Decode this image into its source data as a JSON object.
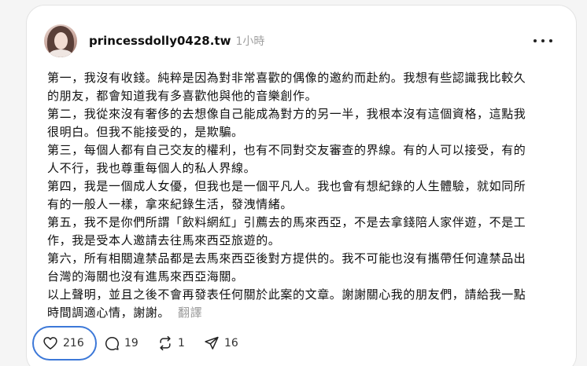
{
  "post": {
    "username": "princessdolly0428.tw",
    "time": "1小時",
    "lines": [
      "第一，我沒有收錢。純粹是因為對非常喜歡的偶像的邀約而赴約。我想有些認識我比較久",
      "的朋友，都會知道我有多喜歡他與他的音樂創作。",
      "第二，我從來沒有奢侈的去想像自己能成為對方的另一半，我根本沒有這個資格，這點我",
      "很明白。但我不能接受的，是欺騙。",
      "第三，每個人都有自己交友的權利，也有不同對交友審查的界線。有的人可以接受，有的",
      "人不行，我也尊重每個人的私人界線。",
      "第四，我是一個成人女優，但我也是一個平凡人。我也會有想紀錄的人生體驗，就如同所",
      "有的一般人一樣，拿來紀錄生活，發洩情緒。",
      "第五，我不是你們所謂「飲料網紅」引薦去的馬來西亞，不是去拿錢陪人家伴遊，不是工",
      "作，我是受本人邀請去往馬來西亞旅遊的。",
      "第六，所有相關違禁品都是去馬來西亞後對方提供的。我不可能也沒有攜帶任何違禁品出",
      "台灣的海關也沒有進馬來西亞海關。",
      "以上聲明，並且之後不會再發表任何關於此案的文章。謝謝關心我的朋友們，請給我一點",
      "時間調適心情，謝謝。"
    ],
    "translate_label": "翻譯"
  },
  "actions": {
    "likes": "216",
    "replies": "19",
    "reposts": "1",
    "shares": "16"
  },
  "colors": {
    "highlight_ring": "#3c78d8"
  }
}
